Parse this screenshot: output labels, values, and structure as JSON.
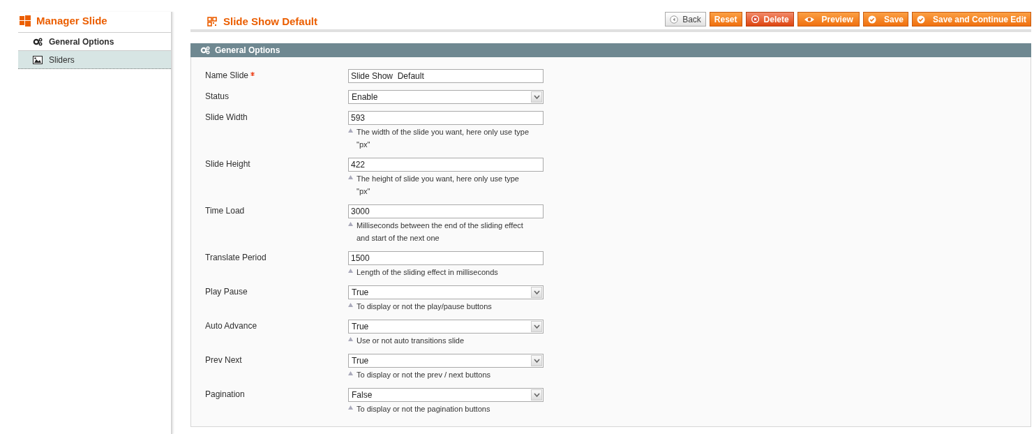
{
  "sidebar": {
    "title": "Manager Slide",
    "items": [
      {
        "label": "General Options",
        "selected": true,
        "kind": "gears"
      },
      {
        "label": "Sliders",
        "selected": false,
        "kind": "image"
      }
    ]
  },
  "page": {
    "title": "Slide Show Default"
  },
  "buttons": [
    {
      "label": "Back",
      "kind": "back"
    },
    {
      "label": "Reset",
      "kind": "plain"
    },
    {
      "label": "Delete",
      "kind": "delete"
    },
    {
      "label": "Preview",
      "kind": "preview"
    },
    {
      "label": "Save",
      "kind": "save"
    },
    {
      "label": "Save and Continue Edit",
      "kind": "save"
    }
  ],
  "panel": {
    "title": "General Options",
    "fields": [
      {
        "label": "Name Slide",
        "required": true,
        "kind": "input",
        "value": "Slide Show  Default"
      },
      {
        "label": "Status",
        "required": false,
        "kind": "select",
        "value": "Enable"
      },
      {
        "label": "Slide Width",
        "required": false,
        "kind": "input",
        "value": "593",
        "note": [
          "The width of the slide you want, here only use type",
          "\"px\""
        ]
      },
      {
        "label": "Slide Height",
        "required": false,
        "kind": "input",
        "value": "422",
        "note": [
          "The height of slide you want, here only use type",
          "\"px\""
        ]
      },
      {
        "label": "Time Load",
        "required": false,
        "kind": "input",
        "value": "3000",
        "note": [
          "Milliseconds between the end of the sliding effect",
          "and start of the next one"
        ]
      },
      {
        "label": "Translate Period",
        "required": false,
        "kind": "input",
        "value": "1500",
        "note": [
          "Length of the sliding effect in milliseconds"
        ]
      },
      {
        "label": "Play Pause",
        "required": false,
        "kind": "select",
        "value": "True",
        "note": [
          "To display or not the play/pause buttons"
        ]
      },
      {
        "label": "Auto Advance",
        "required": false,
        "kind": "select",
        "value": "True",
        "note": [
          "Use or not auto transitions slide"
        ]
      },
      {
        "label": "Prev Next",
        "required": false,
        "kind": "select",
        "value": "True",
        "note": [
          "To display or not the prev / next buttons"
        ]
      },
      {
        "label": "Pagination",
        "required": false,
        "kind": "select",
        "value": "False",
        "note": [
          "To display or not the pagination buttons"
        ]
      }
    ]
  }
}
